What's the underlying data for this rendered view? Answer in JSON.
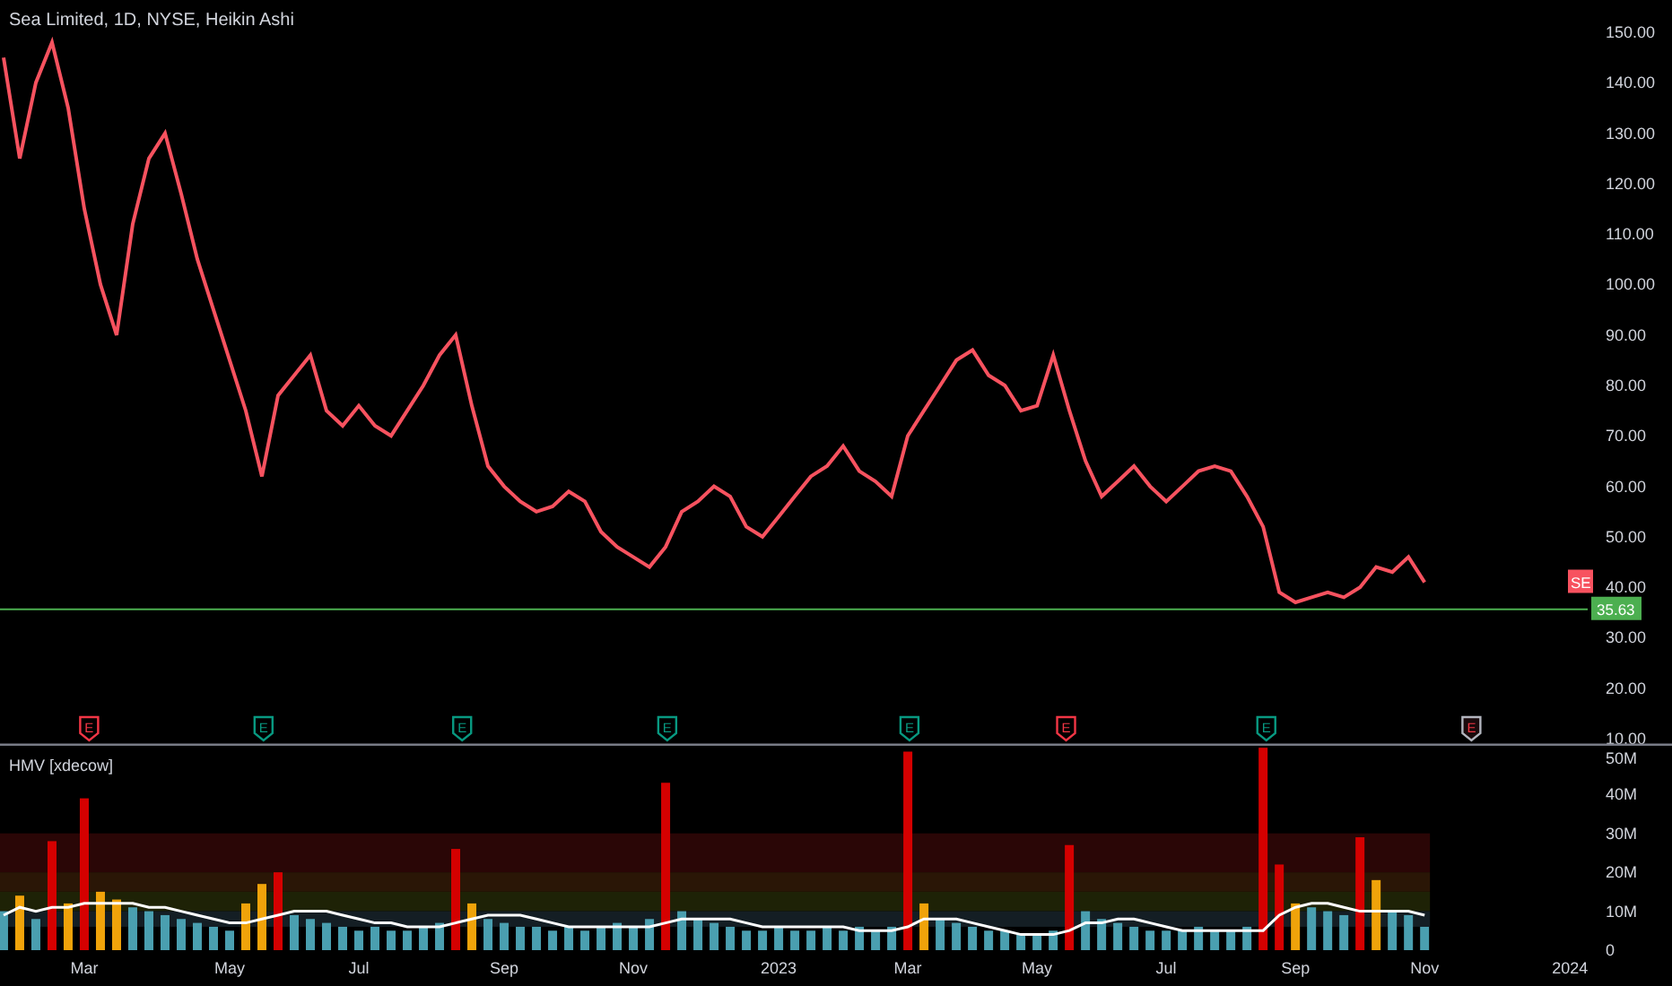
{
  "header": {
    "title": "Sea Limited, 1D, NYSE, Heikin Ashi"
  },
  "price_chart": {
    "chart_data": {
      "type": "line",
      "categories": [
        null,
        null,
        null,
        null,
        null,
        null,
        null,
        null,
        null,
        null,
        null,
        null,
        null,
        null,
        null,
        null,
        null,
        null,
        null,
        null,
        null,
        null,
        null,
        null,
        null,
        null,
        null,
        null,
        null,
        null,
        null,
        null,
        null,
        null,
        null,
        null,
        null,
        null,
        null,
        null,
        null,
        null,
        null,
        null,
        null,
        null,
        null,
        null,
        null,
        null,
        null,
        null,
        null,
        null,
        null,
        null,
        null,
        null,
        null,
        null,
        null,
        null,
        null,
        null,
        null,
        null,
        null,
        null,
        null,
        null,
        null,
        null,
        null,
        null,
        null,
        null,
        null,
        null,
        null,
        null,
        null,
        null,
        null,
        null,
        null,
        null,
        null,
        null,
        null,
        null,
        null,
        null,
        null,
        null,
        null,
        null,
        null,
        null
      ],
      "series": [
        {
          "name": "SE",
          "color": "#f7525f",
          "values": [
            145,
            125,
            140,
            148,
            135,
            115,
            100,
            90,
            112,
            125,
            130,
            118,
            105,
            95,
            85,
            75,
            62,
            78,
            82,
            86,
            75,
            72,
            76,
            72,
            70,
            75,
            80,
            86,
            90,
            76,
            64,
            60,
            57,
            55,
            56,
            59,
            57,
            51,
            48,
            46,
            44,
            48,
            55,
            57,
            60,
            58,
            52,
            50,
            54,
            58,
            62,
            64,
            68,
            63,
            61,
            58,
            70,
            75,
            80,
            85,
            87,
            82,
            80,
            75,
            76,
            86,
            75,
            65,
            58,
            61,
            64,
            60,
            57,
            60,
            63,
            64,
            63,
            58,
            52,
            39,
            37,
            38,
            39,
            38,
            40,
            44,
            43,
            46,
            41,
            null,
            null,
            null,
            null,
            null,
            null,
            null,
            null,
            null
          ]
        }
      ],
      "ylim": [
        10,
        150
      ],
      "yticks": [
        {
          "value": 150,
          "label": "150.00"
        },
        {
          "value": 140,
          "label": "140.00"
        },
        {
          "value": 130,
          "label": "130.00"
        },
        {
          "value": 120,
          "label": "120.00"
        },
        {
          "value": 110,
          "label": "110.00"
        },
        {
          "value": 100,
          "label": "100.00"
        },
        {
          "value": 90,
          "label": "90.00"
        },
        {
          "value": 80,
          "label": "80.00"
        },
        {
          "value": 70,
          "label": "70.00"
        },
        {
          "value": 60,
          "label": "60.00"
        },
        {
          "value": 50,
          "label": "50.00"
        },
        {
          "value": 40,
          "label": "40.00"
        },
        {
          "value": 30,
          "label": "30.00"
        },
        {
          "value": 20,
          "label": "20.00"
        },
        {
          "value": 10,
          "label": "10.00"
        }
      ]
    },
    "price_line": {
      "label": "35.63",
      "color": "#4caf50"
    },
    "earnings": [
      {
        "label": "E",
        "kind": "reported",
        "color": "#f23645"
      },
      {
        "label": "E",
        "kind": "reported",
        "color": "#089981"
      },
      {
        "label": "E",
        "kind": "reported",
        "color": "#089981"
      },
      {
        "label": "E",
        "kind": "reported",
        "color": "#089981"
      },
      {
        "label": "E",
        "kind": "reported",
        "color": "#089981"
      },
      {
        "label": "E",
        "kind": "reported",
        "color": "#f23645"
      },
      {
        "label": "E",
        "kind": "reported",
        "color": "#089981"
      },
      {
        "label": "E",
        "kind": "upcoming",
        "color": "#f23645"
      }
    ]
  },
  "volume_chart": {
    "title": "HMV [xdecow]",
    "chart_data": {
      "type": "bar",
      "categories": [
        null,
        null,
        null,
        null,
        null,
        "Mar",
        null,
        null,
        null,
        null,
        null,
        null,
        null,
        null,
        "May",
        null,
        null,
        null,
        null,
        null,
        null,
        null,
        "Jul",
        null,
        null,
        null,
        null,
        null,
        null,
        null,
        null,
        "Sep",
        null,
        null,
        null,
        null,
        null,
        null,
        null,
        "Nov",
        null,
        null,
        null,
        null,
        null,
        null,
        null,
        null,
        "2023",
        null,
        null,
        null,
        null,
        null,
        null,
        null,
        "Mar",
        null,
        null,
        null,
        null,
        null,
        null,
        null,
        "May",
        null,
        null,
        null,
        null,
        null,
        null,
        null,
        "Jul",
        null,
        null,
        null,
        null,
        null,
        null,
        null,
        "Sep",
        null,
        null,
        null,
        null,
        null,
        null,
        null,
        "Nov",
        null,
        null,
        null,
        null,
        null,
        null,
        null,
        null,
        "2024"
      ],
      "series": [
        {
          "color": "#4a9fb0",
          "values": [
            10,
            null,
            8,
            null,
            null,
            null,
            null,
            null,
            11,
            10,
            9,
            8,
            7,
            6,
            5,
            null,
            null,
            null,
            9,
            8,
            7,
            6,
            5,
            6,
            5,
            5,
            6,
            7,
            null,
            null,
            8,
            7,
            6,
            6,
            5,
            6,
            5,
            6,
            7,
            6,
            8,
            null,
            10,
            8,
            7,
            6,
            5,
            5,
            6,
            5,
            5,
            6,
            5,
            6,
            5,
            6,
            null,
            null,
            8,
            7,
            6,
            5,
            5,
            4,
            4,
            5,
            null,
            10,
            8,
            7,
            6,
            5,
            5,
            5,
            6,
            5,
            5,
            6,
            null,
            null,
            null,
            11,
            10,
            9,
            null,
            null,
            10,
            9,
            6,
            null,
            null,
            null,
            null,
            null,
            null,
            null,
            null,
            null
          ]
        },
        {
          "color": "#f0a30a",
          "values": [
            null,
            14,
            null,
            null,
            12,
            null,
            15,
            13,
            null,
            null,
            null,
            null,
            null,
            null,
            null,
            12,
            17,
            null,
            null,
            null,
            null,
            null,
            null,
            null,
            null,
            null,
            null,
            null,
            null,
            12,
            null,
            null,
            null,
            null,
            null,
            null,
            null,
            null,
            null,
            null,
            null,
            null,
            null,
            null,
            null,
            null,
            null,
            null,
            null,
            null,
            null,
            null,
            null,
            null,
            null,
            null,
            null,
            12,
            null,
            null,
            null,
            null,
            null,
            null,
            null,
            null,
            null,
            null,
            null,
            null,
            null,
            null,
            null,
            null,
            null,
            null,
            null,
            null,
            null,
            null,
            12,
            null,
            null,
            null,
            null,
            18,
            null,
            null,
            null,
            null,
            null,
            null,
            null,
            null,
            null,
            null,
            null,
            null
          ]
        },
        {
          "color": "#d50000",
          "values": [
            null,
            null,
            null,
            28,
            null,
            39,
            null,
            null,
            null,
            null,
            null,
            null,
            null,
            null,
            null,
            null,
            null,
            20,
            null,
            null,
            null,
            null,
            null,
            null,
            null,
            null,
            null,
            null,
            26,
            null,
            null,
            null,
            null,
            null,
            null,
            null,
            null,
            null,
            null,
            null,
            null,
            43,
            null,
            null,
            null,
            null,
            null,
            null,
            null,
            null,
            null,
            null,
            null,
            null,
            null,
            null,
            51,
            null,
            null,
            null,
            null,
            null,
            null,
            null,
            null,
            null,
            27,
            null,
            null,
            null,
            null,
            null,
            null,
            null,
            null,
            null,
            null,
            null,
            52,
            22,
            null,
            null,
            null,
            null,
            29,
            null,
            null,
            null,
            null,
            null,
            null,
            null,
            null,
            null,
            null,
            null,
            null,
            null
          ]
        },
        {
          "type": "line",
          "color": "#ffffff",
          "values": [
            9,
            11,
            10,
            11,
            11,
            12,
            12,
            12,
            12,
            11,
            11,
            10,
            9,
            8,
            7,
            7,
            8,
            9,
            10,
            10,
            10,
            9,
            8,
            7,
            7,
            6,
            6,
            6,
            7,
            8,
            9,
            9,
            9,
            8,
            7,
            6,
            6,
            6,
            6,
            6,
            6,
            7,
            8,
            8,
            8,
            8,
            7,
            6,
            6,
            6,
            6,
            6,
            6,
            5,
            5,
            5,
            6,
            8,
            8,
            8,
            7,
            6,
            5,
            4,
            4,
            4,
            5,
            7,
            7,
            8,
            8,
            7,
            6,
            5,
            5,
            5,
            5,
            5,
            5,
            9,
            11,
            12,
            12,
            11,
            10,
            10,
            10,
            10,
            9,
            null,
            null,
            null,
            null,
            null,
            null,
            null,
            null,
            null
          ]
        }
      ],
      "ylim": [
        0,
        52.5
      ],
      "yticks": [
        {
          "value": 50,
          "label": "50M"
        },
        {
          "value": 40,
          "label": "40M"
        },
        {
          "value": 30,
          "label": "30M"
        },
        {
          "value": 20,
          "label": "20M"
        },
        {
          "value": 10,
          "label": "10M"
        },
        {
          "value": 0,
          "label": "0"
        }
      ]
    }
  }
}
